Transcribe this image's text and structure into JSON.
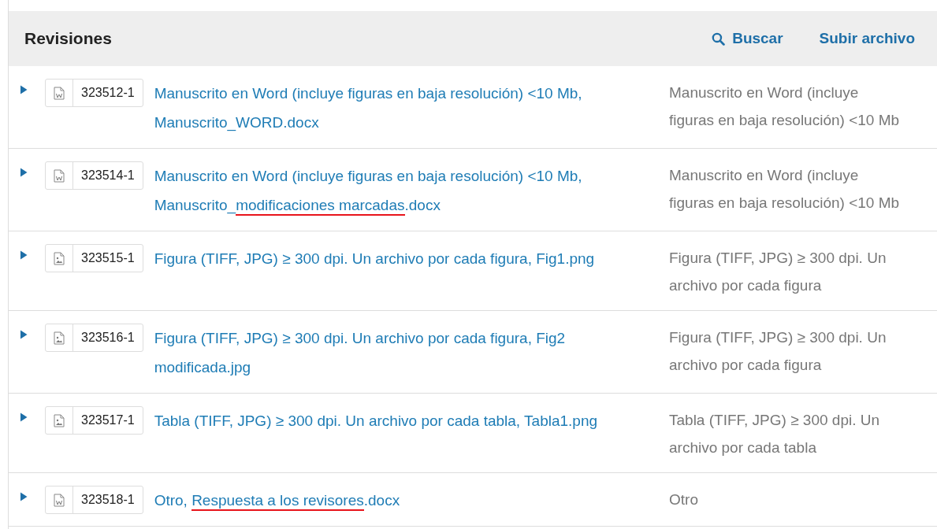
{
  "panel": {
    "title": "Revisiones",
    "actions": [
      {
        "kind": "search",
        "label": "Buscar"
      },
      {
        "kind": "upload",
        "label": "Subir archivo"
      }
    ]
  },
  "files": [
    {
      "expanded": false,
      "kind": "word",
      "id": "323512-1",
      "link": [
        {
          "text": "Manuscrito en Word (incluye figuras en baja resolución) <10 Mb, Manuscrito_WORD.docx",
          "underlined": false
        }
      ],
      "description": "Manuscrito en Word (incluye figuras en baja resolución) <10 Mb"
    },
    {
      "expanded": false,
      "kind": "word",
      "id": "323514-1",
      "link": [
        {
          "text": "Manuscrito en Word (incluye figuras en baja resolución) <10 Mb, Manuscrito_",
          "underlined": false
        },
        {
          "text": "modificaciones marcadas",
          "underlined": true
        },
        {
          "text": ".docx",
          "underlined": false
        }
      ],
      "description": "Manuscrito en Word (incluye figuras en baja resolución) <10 Mb"
    },
    {
      "expanded": false,
      "kind": "image",
      "id": "323515-1",
      "link": [
        {
          "text": "Figura (TIFF, JPG) ≥ 300 dpi. Un archivo por cada figura, Fig1.png",
          "underlined": false
        }
      ],
      "description": "Figura (TIFF, JPG) ≥ 300 dpi. Un archivo por cada figura"
    },
    {
      "expanded": false,
      "kind": "image",
      "id": "323516-1",
      "link": [
        {
          "text": "Figura (TIFF, JPG) ≥ 300 dpi. Un archivo por cada figura, Fig2 modificada.jpg",
          "underlined": false
        }
      ],
      "description": "Figura (TIFF, JPG) ≥ 300 dpi. Un archivo por cada figura"
    },
    {
      "expanded": false,
      "kind": "image",
      "id": "323517-1",
      "link": [
        {
          "text": "Tabla (TIFF, JPG) ≥ 300 dpi. Un archivo por cada tabla, Tabla1.png",
          "underlined": false
        }
      ],
      "description": "Tabla (TIFF, JPG) ≥ 300 dpi. Un archivo por cada tabla"
    },
    {
      "expanded": false,
      "kind": "word",
      "id": "323518-1",
      "link": [
        {
          "text": "Otro, ",
          "underlined": false
        },
        {
          "text": "Respuesta a los revisores",
          "underlined": true
        },
        {
          "text": ".docx",
          "underlined": false
        }
      ],
      "description": "Otro"
    }
  ]
}
